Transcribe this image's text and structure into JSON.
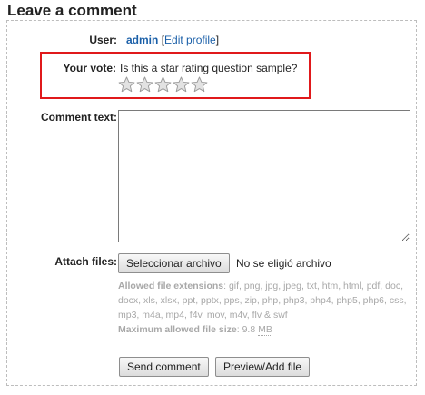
{
  "heading": "Leave a comment",
  "user": {
    "label": "User:",
    "name": "admin",
    "edit_open": "[",
    "edit_link": "Edit profile",
    "edit_close": "]"
  },
  "vote": {
    "label": "Your vote:",
    "question": "Is this a star rating question sample?",
    "star_count": 5,
    "selected": 0,
    "highlight_color": "#e0191b"
  },
  "comment": {
    "label": "Comment text:",
    "value": ""
  },
  "attach": {
    "label": "Attach files:",
    "button": "Seleccionar archivo",
    "status": "No se eligió archivo",
    "extensions_label": "Allowed file extensions",
    "extensions": "gif, png, jpg, jpeg, txt, htm, html, pdf, doc, docx, xls, xlsx, ppt, pptx, pps, zip, php, php3, php4, php5, php6, css, mp3, m4a, mp4, f4v, mov, m4v, flv & swf",
    "max_size_label": "Maximum allowed file size",
    "max_size_value": "9.8",
    "max_size_unit": "MB"
  },
  "buttons": {
    "send": "Send comment",
    "preview": "Preview/Add file"
  }
}
